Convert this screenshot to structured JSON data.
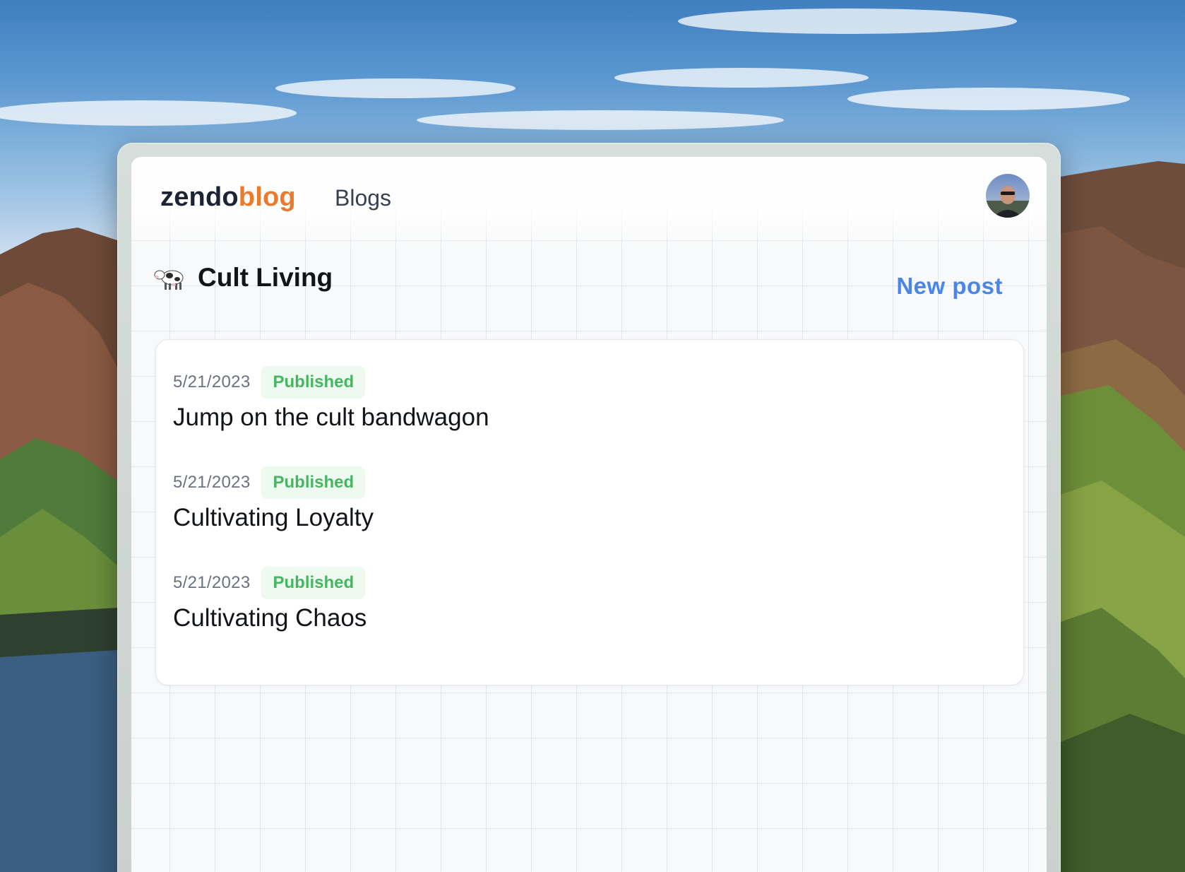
{
  "app": {
    "logo_part1": "zendo",
    "logo_part2": "blog",
    "nav_blogs": "Blogs"
  },
  "blog": {
    "emoji": "cow-emoji",
    "title": "Cult Living",
    "new_post_label": "New post"
  },
  "posts": [
    {
      "date": "5/21/2023",
      "status": "Published",
      "title": "Jump on the cult bandwagon"
    },
    {
      "date": "5/21/2023",
      "status": "Published",
      "title": "Cultivating Loyalty"
    },
    {
      "date": "5/21/2023",
      "status": "Published",
      "title": "Cultivating Chaos"
    }
  ],
  "colors": {
    "brand_dark": "#1c2433",
    "brand_accent": "#ea7a2d",
    "link": "#4a86e8",
    "status_published": "#48b562"
  }
}
